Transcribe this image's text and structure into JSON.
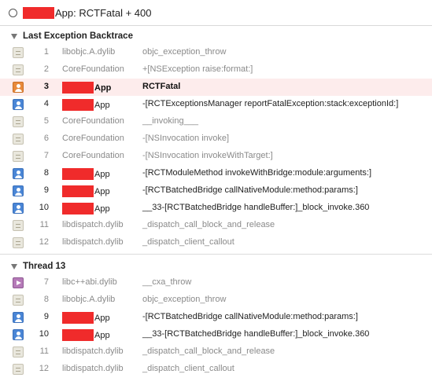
{
  "window": {
    "title_suffix": "App: RCTFatal + 400"
  },
  "sections": [
    {
      "title": "Last Exception Backtrace",
      "frames": [
        {
          "num": "1",
          "module": "libobjc.A.dylib",
          "symbol": "objc_exception_throw",
          "icon": "library-icon"
        },
        {
          "num": "2",
          "module": "CoreFoundation",
          "symbol": "+[NSException raise:format:]",
          "icon": "library-icon"
        },
        {
          "num": "3",
          "module": "App",
          "symbol": "RCTFatal",
          "icon": "user-code-icon",
          "selected": true
        },
        {
          "num": "4",
          "module": "App",
          "symbol": "-[RCTExceptionsManager reportFatalException:stack:exceptionId:]",
          "icon": "user-code-icon"
        },
        {
          "num": "5",
          "module": "CoreFoundation",
          "symbol": "__invoking___",
          "icon": "library-icon"
        },
        {
          "num": "6",
          "module": "CoreFoundation",
          "symbol": "-[NSInvocation invoke]",
          "icon": "library-icon"
        },
        {
          "num": "7",
          "module": "CoreFoundation",
          "symbol": "-[NSInvocation invokeWithTarget:]",
          "icon": "library-icon"
        },
        {
          "num": "8",
          "module": "App",
          "symbol": "-[RCTModuleMethod invokeWithBridge:module:arguments:]",
          "icon": "user-code-icon"
        },
        {
          "num": "9",
          "module": "App",
          "symbol": "-[RCTBatchedBridge callNativeModule:method:params:]",
          "icon": "user-code-icon"
        },
        {
          "num": "10",
          "module": "App",
          "symbol": "__33-[RCTBatchedBridge handleBuffer:]_block_invoke.360",
          "icon": "user-code-icon"
        },
        {
          "num": "11",
          "module": "libdispatch.dylib",
          "symbol": "_dispatch_call_block_and_release",
          "icon": "library-icon"
        },
        {
          "num": "12",
          "module": "libdispatch.dylib",
          "symbol": "_dispatch_client_callout",
          "icon": "library-icon"
        }
      ]
    },
    {
      "title": "Thread 13",
      "frames": [
        {
          "num": "7",
          "module": "libc++abi.dylib",
          "symbol": "__cxa_throw",
          "icon": "cxx-runtime-icon"
        },
        {
          "num": "8",
          "module": "libobjc.A.dylib",
          "symbol": "objc_exception_throw",
          "icon": "library-icon"
        },
        {
          "num": "9",
          "module": "App",
          "symbol": "-[RCTBatchedBridge callNativeModule:method:params:]",
          "icon": "user-code-icon"
        },
        {
          "num": "10",
          "module": "App",
          "symbol": "__33-[RCTBatchedBridge handleBuffer:]_block_invoke.360",
          "icon": "user-code-icon"
        },
        {
          "num": "11",
          "module": "libdispatch.dylib",
          "symbol": "_dispatch_call_block_and_release",
          "icon": "library-icon"
        },
        {
          "num": "12",
          "module": "libdispatch.dylib",
          "symbol": "_dispatch_client_callout",
          "icon": "library-icon"
        }
      ]
    }
  ],
  "colors": {
    "redaction": "#f02b2b",
    "selected_row": "#fdecec",
    "user_icon": "#4a86d6",
    "selected_icon": "#e88a3c"
  }
}
